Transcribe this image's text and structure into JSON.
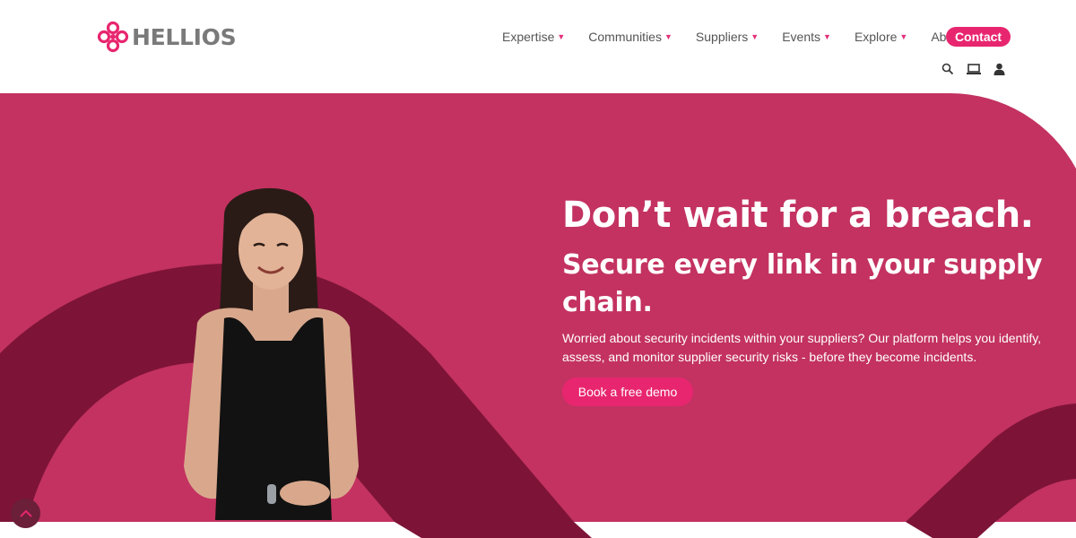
{
  "header": {
    "logo_text": "HELLIOS",
    "nav": [
      {
        "label": "Expertise"
      },
      {
        "label": "Communities"
      },
      {
        "label": "Suppliers"
      },
      {
        "label": "Events"
      },
      {
        "label": "Explore"
      },
      {
        "label": "About"
      }
    ],
    "contact_label": "Contact",
    "icons": [
      "search-icon",
      "laptop-icon",
      "user-icon"
    ]
  },
  "hero": {
    "headline": "Don’t wait for a breach.",
    "subheadline": "Secure every link in your supply chain.",
    "body": "Worried about security incidents within your suppliers? Our platform helps you identify, assess, and monitor supplier security risks - before they become incidents.",
    "cta_label": "Book a free demo"
  },
  "colors": {
    "brand_pink": "#e8266f",
    "hero_bg": "#c33261",
    "hero_dark": "#7d1437",
    "nav_text": "#555555"
  }
}
